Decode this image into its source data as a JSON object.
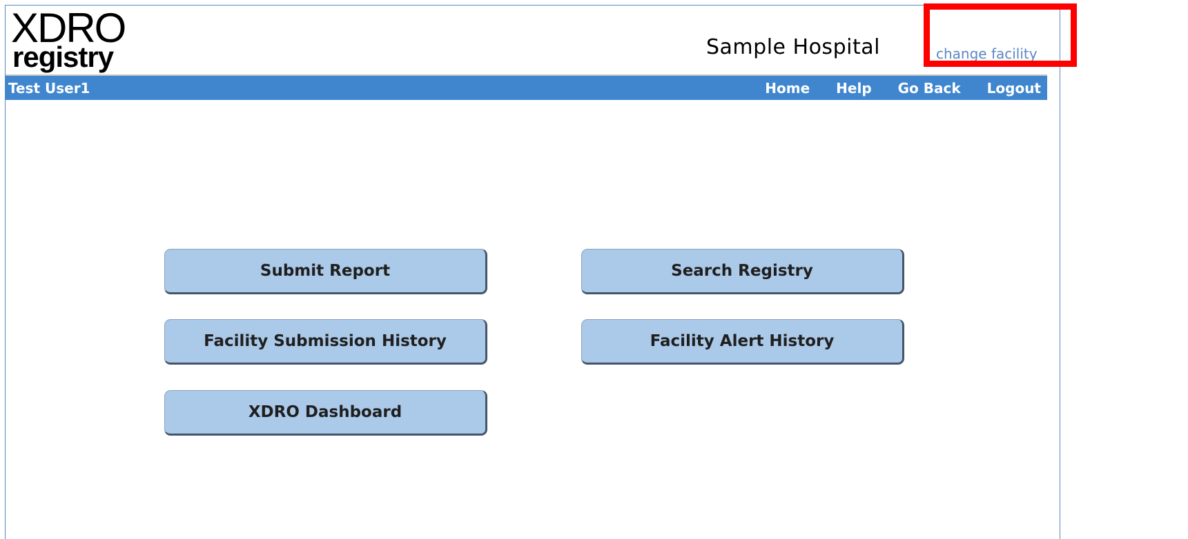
{
  "header": {
    "logo_top": "XDRO",
    "logo_bottom": "registry",
    "facility_name": "Sample Hospital",
    "change_facility_label": "change facility"
  },
  "navbar": {
    "user_name": "Test User1",
    "links": [
      "Home",
      "Help",
      "Go Back",
      "Logout"
    ]
  },
  "main": {
    "buttons": {
      "submit_report": "Submit Report",
      "search_registry": "Search Registry",
      "facility_submission_history": "Facility Submission History",
      "facility_alert_history": "Facility Alert History",
      "xdro_dashboard": "XDRO Dashboard"
    }
  },
  "colors": {
    "navbar_bg": "#3f86cf",
    "button_bg": "#abc9e8",
    "link_color": "#5b86c4",
    "highlight": "#ff0000"
  }
}
